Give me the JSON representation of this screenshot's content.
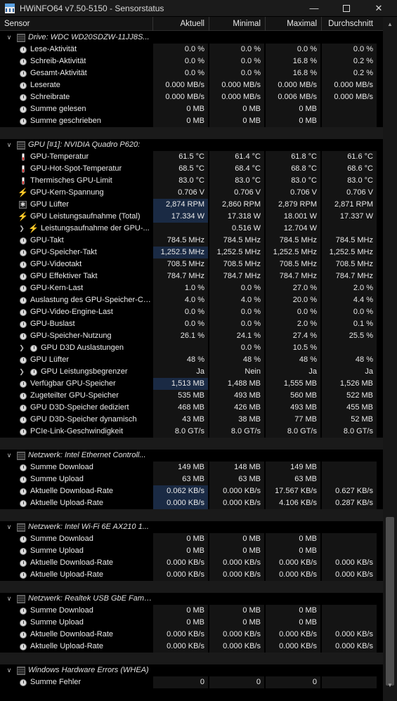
{
  "window": {
    "title": "HWiNFO64 v7.50-5150 - Sensorstatus",
    "icon": "hwinfo-app-icon",
    "minimize": "—",
    "close": "✕"
  },
  "columns": [
    "Sensor",
    "Aktuell",
    "Minimal",
    "Maximal",
    "Durchschnitt"
  ],
  "rows": [
    {
      "type": "group",
      "name": "Drive: WDC WD20SDZW-11JJ8S..."
    },
    {
      "type": "sensor",
      "icon": "clock",
      "name": "Lese-Aktivität",
      "values": [
        "0.0 %",
        "0.0 %",
        "0.0 %",
        "0.0 %"
      ]
    },
    {
      "type": "sensor",
      "icon": "clock",
      "name": "Schreib-Aktivität",
      "values": [
        "0.0 %",
        "0.0 %",
        "16.8 %",
        "0.2 %"
      ]
    },
    {
      "type": "sensor",
      "icon": "clock",
      "name": "Gesamt-Aktivität",
      "values": [
        "0.0 %",
        "0.0 %",
        "16.8 %",
        "0.2 %"
      ]
    },
    {
      "type": "sensor",
      "icon": "clock",
      "name": "Leserate",
      "values": [
        "0.000 MB/s",
        "0.000 MB/s",
        "0.000 MB/s",
        "0.000 MB/s"
      ]
    },
    {
      "type": "sensor",
      "icon": "clock",
      "name": "Schreibrate",
      "values": [
        "0.000 MB/s",
        "0.000 MB/s",
        "0.006 MB/s",
        "0.000 MB/s"
      ]
    },
    {
      "type": "sensor",
      "icon": "clock",
      "name": "Summe gelesen",
      "values": [
        "0 MB",
        "0 MB",
        "0 MB",
        ""
      ]
    },
    {
      "type": "sensor",
      "icon": "clock",
      "name": "Summe geschrieben",
      "values": [
        "0 MB",
        "0 MB",
        "0 MB",
        ""
      ]
    },
    {
      "type": "spacer"
    },
    {
      "type": "group",
      "name": "GPU [#1]: NVIDIA Quadro P620:"
    },
    {
      "type": "sensor",
      "icon": "therm",
      "name": "GPU-Temperatur",
      "values": [
        "61.5 °C",
        "61.4 °C",
        "61.8 °C",
        "61.6 °C"
      ]
    },
    {
      "type": "sensor",
      "icon": "therm",
      "name": "GPU-Hot-Spot-Temperatur",
      "values": [
        "68.5 °C",
        "68.4 °C",
        "68.8 °C",
        "68.6 °C"
      ]
    },
    {
      "type": "sensor",
      "icon": "therm",
      "name": "Thermisches GPU-Limit",
      "values": [
        "83.0 °C",
        "83.0 °C",
        "83.0 °C",
        "83.0 °C"
      ]
    },
    {
      "type": "sensor",
      "icon": "bolt",
      "name": "GPU-Kern-Spannung",
      "values": [
        "0.706 V",
        "0.706 V",
        "0.706 V",
        "0.706 V"
      ]
    },
    {
      "type": "sensor",
      "icon": "fan",
      "name": "GPU Lüfter",
      "values": [
        "2,874 RPM",
        "2,860 RPM",
        "2,879 RPM",
        "2,871 RPM"
      ],
      "highlight": true
    },
    {
      "type": "sensor",
      "icon": "bolt",
      "name": "GPU Leistungsaufnahme (Total)",
      "values": [
        "17.334 W",
        "17.318 W",
        "18.001 W",
        "17.337 W"
      ],
      "highlight": true
    },
    {
      "type": "subgroup",
      "icon": "bolt",
      "name": "Leistungsaufnahme der GPU-...",
      "values": [
        "",
        "0.516 W",
        "12.704 W",
        ""
      ]
    },
    {
      "type": "sensor",
      "icon": "clock",
      "name": "GPU-Takt",
      "values": [
        "784.5 MHz",
        "784.5 MHz",
        "784.5 MHz",
        "784.5 MHz"
      ]
    },
    {
      "type": "sensor",
      "icon": "clock",
      "name": "GPU-Speicher-Takt",
      "values": [
        "1,252.5 MHz",
        "1,252.5 MHz",
        "1,252.5 MHz",
        "1,252.5 MHz"
      ],
      "highlight": true
    },
    {
      "type": "sensor",
      "icon": "clock",
      "name": "GPU-Videotakt",
      "values": [
        "708.5 MHz",
        "708.5 MHz",
        "708.5 MHz",
        "708.5 MHz"
      ]
    },
    {
      "type": "sensor",
      "icon": "clock",
      "name": "GPU Effektiver Takt",
      "values": [
        "784.7 MHz",
        "784.7 MHz",
        "784.7 MHz",
        "784.7 MHz"
      ]
    },
    {
      "type": "sensor",
      "icon": "clock",
      "name": "GPU-Kern-Last",
      "values": [
        "1.0 %",
        "0.0 %",
        "27.0 %",
        "2.0 %"
      ]
    },
    {
      "type": "sensor",
      "icon": "clock",
      "name": "Auslastung des GPU-Speicher-Co...",
      "values": [
        "4.0 %",
        "4.0 %",
        "20.0 %",
        "4.4 %"
      ]
    },
    {
      "type": "sensor",
      "icon": "clock",
      "name": "GPU-Video-Engine-Last",
      "values": [
        "0.0 %",
        "0.0 %",
        "0.0 %",
        "0.0 %"
      ]
    },
    {
      "type": "sensor",
      "icon": "clock",
      "name": "GPU-Buslast",
      "values": [
        "0.0 %",
        "0.0 %",
        "2.0 %",
        "0.1 %"
      ]
    },
    {
      "type": "sensor",
      "icon": "clock",
      "name": "GPU-Speicher-Nutzung",
      "values": [
        "26.1 %",
        "24.1 %",
        "27.4 %",
        "25.5 %"
      ]
    },
    {
      "type": "subgroup",
      "icon": "clock",
      "name": "GPU D3D Auslastungen",
      "values": [
        "",
        "0.0 %",
        "10.5 %",
        ""
      ]
    },
    {
      "type": "sensor",
      "icon": "clock",
      "name": "GPU Lüfter",
      "values": [
        "48 %",
        "48 %",
        "48 %",
        "48 %"
      ]
    },
    {
      "type": "subgroup",
      "icon": "clock",
      "name": "GPU Leistungsbegrenzer",
      "values": [
        "Ja",
        "Nein",
        "Ja",
        "Ja"
      ]
    },
    {
      "type": "sensor",
      "icon": "clock",
      "name": "Verfügbar GPU-Speicher",
      "values": [
        "1,513 MB",
        "1,488 MB",
        "1,555 MB",
        "1,526 MB"
      ],
      "highlight": true
    },
    {
      "type": "sensor",
      "icon": "clock",
      "name": "Zugeteilter GPU-Speicher",
      "values": [
        "535 MB",
        "493 MB",
        "560 MB",
        "522 MB"
      ]
    },
    {
      "type": "sensor",
      "icon": "clock",
      "name": "GPU D3D-Speicher dediziert",
      "values": [
        "468 MB",
        "426 MB",
        "493 MB",
        "455 MB"
      ]
    },
    {
      "type": "sensor",
      "icon": "clock",
      "name": "GPU D3D-Speicher dynamisch",
      "values": [
        "43 MB",
        "38 MB",
        "77 MB",
        "52 MB"
      ]
    },
    {
      "type": "sensor",
      "icon": "clock",
      "name": "PCIe-Link-Geschwindigkeit",
      "values": [
        "8.0 GT/s",
        "8.0 GT/s",
        "8.0 GT/s",
        "8.0 GT/s"
      ]
    },
    {
      "type": "spacer"
    },
    {
      "type": "group",
      "name": "Netzwerk: Intel Ethernet Controll..."
    },
    {
      "type": "sensor",
      "icon": "clock",
      "name": "Summe Download",
      "values": [
        "149 MB",
        "148 MB",
        "149 MB",
        ""
      ]
    },
    {
      "type": "sensor",
      "icon": "clock",
      "name": "Summe Upload",
      "values": [
        "63 MB",
        "63 MB",
        "63 MB",
        ""
      ]
    },
    {
      "type": "sensor",
      "icon": "clock",
      "name": "Aktuelle Download-Rate",
      "values": [
        "0.062 KB/s",
        "0.000 KB/s",
        "17.567 KB/s",
        "0.627 KB/s"
      ],
      "highlight": true
    },
    {
      "type": "sensor",
      "icon": "clock",
      "name": "Aktuelle Upload-Rate",
      "values": [
        "0.000 KB/s",
        "0.000 KB/s",
        "4.106 KB/s",
        "0.287 KB/s"
      ],
      "highlight": true
    },
    {
      "type": "spacer"
    },
    {
      "type": "group",
      "name": "Netzwerk: Intel Wi-Fi 6E AX210 1..."
    },
    {
      "type": "sensor",
      "icon": "clock",
      "name": "Summe Download",
      "values": [
        "0 MB",
        "0 MB",
        "0 MB",
        ""
      ]
    },
    {
      "type": "sensor",
      "icon": "clock",
      "name": "Summe Upload",
      "values": [
        "0 MB",
        "0 MB",
        "0 MB",
        ""
      ]
    },
    {
      "type": "sensor",
      "icon": "clock",
      "name": "Aktuelle Download-Rate",
      "values": [
        "0.000 KB/s",
        "0.000 KB/s",
        "0.000 KB/s",
        "0.000 KB/s"
      ]
    },
    {
      "type": "sensor",
      "icon": "clock",
      "name": "Aktuelle Upload-Rate",
      "values": [
        "0.000 KB/s",
        "0.000 KB/s",
        "0.000 KB/s",
        "0.000 KB/s"
      ]
    },
    {
      "type": "spacer"
    },
    {
      "type": "group",
      "name": "Netzwerk: Realtek USB GbE Famil..."
    },
    {
      "type": "sensor",
      "icon": "clock",
      "name": "Summe Download",
      "values": [
        "0 MB",
        "0 MB",
        "0 MB",
        ""
      ]
    },
    {
      "type": "sensor",
      "icon": "clock",
      "name": "Summe Upload",
      "values": [
        "0 MB",
        "0 MB",
        "0 MB",
        ""
      ]
    },
    {
      "type": "sensor",
      "icon": "clock",
      "name": "Aktuelle Download-Rate",
      "values": [
        "0.000 KB/s",
        "0.000 KB/s",
        "0.000 KB/s",
        "0.000 KB/s"
      ]
    },
    {
      "type": "sensor",
      "icon": "clock",
      "name": "Aktuelle Upload-Rate",
      "values": [
        "0.000 KB/s",
        "0.000 KB/s",
        "0.000 KB/s",
        "0.000 KB/s"
      ]
    },
    {
      "type": "spacer"
    },
    {
      "type": "group",
      "name": "Windows Hardware Errors (WHEA)"
    },
    {
      "type": "sensor",
      "icon": "clock",
      "name": "Summe Fehler",
      "values": [
        "0",
        "0",
        "0",
        ""
      ]
    }
  ]
}
